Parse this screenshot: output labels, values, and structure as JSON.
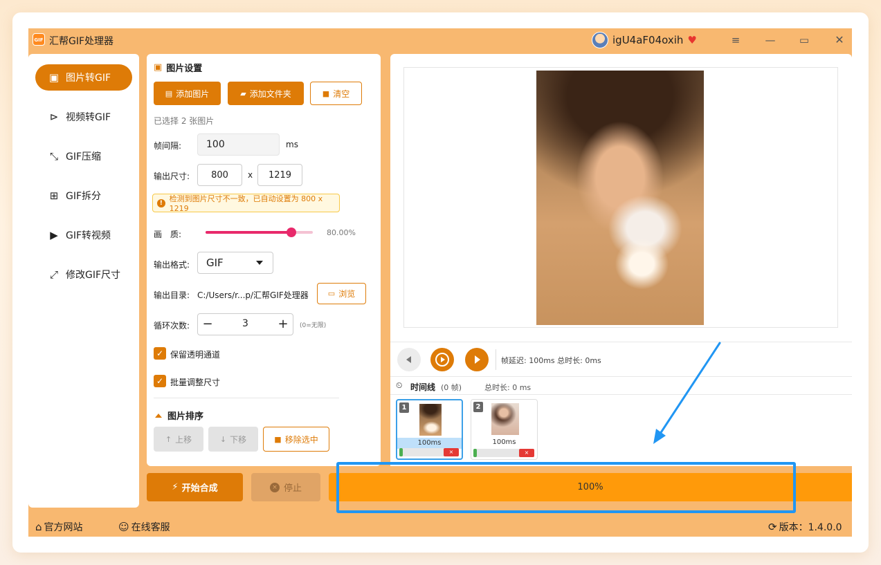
{
  "window": {
    "title": "汇帮GIF处理器",
    "logo_text": "GIF",
    "username": "igU4aF04oxih",
    "vip_icon": "diamond-icon"
  },
  "nav": {
    "items": [
      {
        "label": "图片转GIF",
        "icon": "image-icon",
        "active": true
      },
      {
        "label": "视频转GIF",
        "icon": "play-circle-icon",
        "active": false
      },
      {
        "label": "GIF压缩",
        "icon": "compress-icon",
        "active": false
      },
      {
        "label": "GIF拆分",
        "icon": "split-icon",
        "active": false
      },
      {
        "label": "GIF转视频",
        "icon": "video-icon",
        "active": false
      },
      {
        "label": "修改GIF尺寸",
        "icon": "resize-icon",
        "active": false
      }
    ]
  },
  "settings": {
    "title": "图片设置",
    "add_image": "添加图片",
    "add_folder": "添加文件夹",
    "clear": "清空",
    "selected_text": "已选择 2 张图片",
    "frame_interval_label": "帧间隔:",
    "frame_interval_value": "100",
    "frame_interval_unit": "ms",
    "output_size_label": "输出尺寸:",
    "width": "800",
    "size_sep": "x",
    "height": "1219",
    "warning": "检测到图片尺寸不一致，已自动设置为 800 x 1219",
    "quality_label": "画　质:",
    "quality_value": 80,
    "quality_text": "80.00%",
    "format_label": "输出格式:",
    "format_value": "GIF",
    "output_dir_label": "输出目录:",
    "output_dir_value": "C:/Users/r...p/汇帮GIF处理器",
    "browse": "浏览",
    "loop_label": "循环次数:",
    "loop_value": "3",
    "loop_hint": "(0=无限)",
    "keep_alpha": "保留透明通道",
    "keep_alpha_checked": true,
    "batch_resize": "批量调整尺寸",
    "batch_resize_checked": true,
    "sort_title": "图片排序",
    "move_up": "上移",
    "move_down": "下移",
    "remove_selected": "移除选中"
  },
  "preview": {
    "frame_info": "帧延迟: 100ms  总时长: 0ms"
  },
  "timeline": {
    "title": "时间线",
    "frame_count": "(0 帧)",
    "total": "总时长: 0 ms",
    "frames": [
      {
        "index": "1",
        "delay": "100ms",
        "selected": true
      },
      {
        "index": "2",
        "delay": "100ms",
        "selected": false
      }
    ],
    "delete_symbol": "×"
  },
  "actions": {
    "start": "开始合成",
    "stop": "停止",
    "progress": 100,
    "progress_text": "100%"
  },
  "footer": {
    "website": "官方网站",
    "support": "在线客服",
    "version": "版本：1.4.0.0"
  },
  "colors": {
    "accent": "#de7b07",
    "progress": "#ff9a0a",
    "annotation": "#2196f3"
  }
}
